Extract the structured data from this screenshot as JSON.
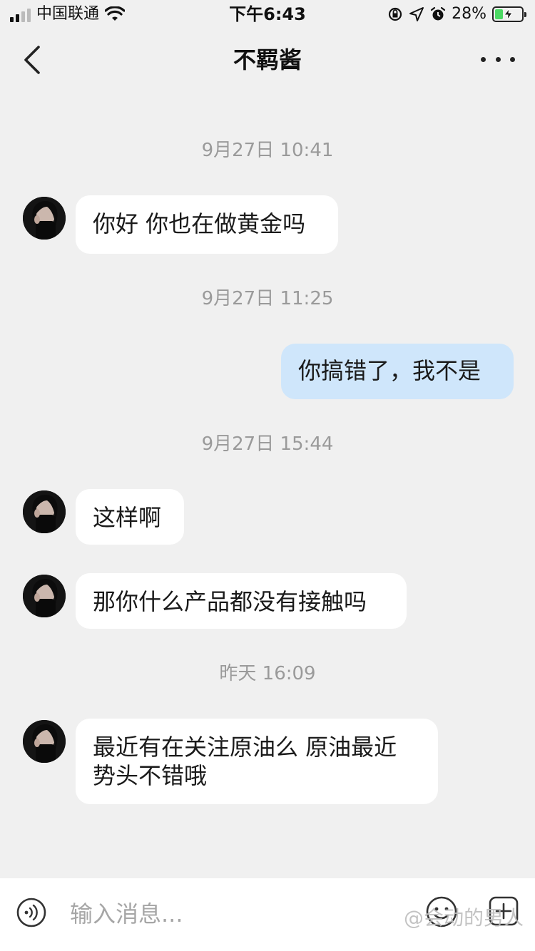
{
  "status_bar": {
    "carrier": "中国联通",
    "time": "下午6:43",
    "battery": "28%"
  },
  "header": {
    "title": "不羁酱"
  },
  "messages": [
    {
      "type": "timestamp",
      "text": "9月27日 10:41"
    },
    {
      "type": "received",
      "text": "你好 你也在做黄金吗"
    },
    {
      "type": "timestamp",
      "text": "9月27日 11:25"
    },
    {
      "type": "sent",
      "text": "你搞错了，我不是"
    },
    {
      "type": "timestamp",
      "text": "9月27日 15:44"
    },
    {
      "type": "received",
      "text": "这样啊"
    },
    {
      "type": "received",
      "text": "那你什么产品都没有接触吗"
    },
    {
      "type": "timestamp",
      "text": "昨天 16:09"
    },
    {
      "type": "received",
      "text": "最近有在关注原油么 原油最近\n势头不错哦"
    }
  ],
  "input_bar": {
    "placeholder": "输入消息..."
  },
  "watermark": "@会动的男人",
  "colors": {
    "background": "#f0f0f0",
    "received_bubble": "#ffffff",
    "sent_bubble": "#cfe6fb",
    "timestamp_text": "#9a9a9a"
  },
  "icons": {
    "back": "chevron-left-icon",
    "more": "more-dots-icon",
    "voice": "voice-icon",
    "emoji": "emoji-icon",
    "plus": "add-icon"
  }
}
